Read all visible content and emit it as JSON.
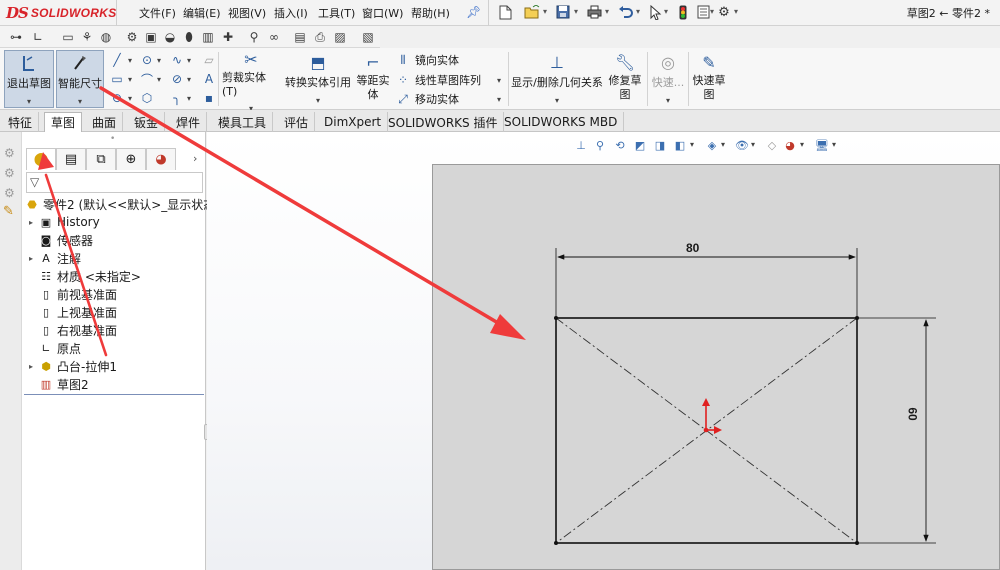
{
  "app": {
    "logo_ds": "DS",
    "logo_name": "SOLIDWORKS",
    "title": "草图2 ← 零件2 *",
    "colors": {
      "brand_red": "#d8232a",
      "sketch_line": "#111111",
      "origin_red": "#e02020",
      "arrow_red": "#ef3b3b"
    }
  },
  "menu": {
    "items": [
      "文件(F)",
      "编辑(E)",
      "视图(V)",
      "插入(I)",
      "工具(T)",
      "窗口(W)",
      "帮助(H)"
    ],
    "pin_icon": "pin-icon"
  },
  "quick_access": {
    "icons": [
      "new-document-icon",
      "open-icon",
      "save-icon",
      "print-icon",
      "undo-icon",
      "select-icon",
      "rebuild-icon",
      "file-properties-icon",
      "options-icon"
    ]
  },
  "command_manager": {
    "exit_sketch": "退出草图",
    "smart_dimension": "智能尺寸",
    "trim_entities": "剪裁实体(T)",
    "convert_entities": "转换实体引用",
    "offset_entities": "等距实体",
    "mirror_entities": "镜向实体",
    "linear_pattern": "线性草图阵列",
    "move_entities": "移动实体",
    "display_delete_relations": "显示/删除几何关系",
    "repair_sketch": "修复草图",
    "quick_snaps": "快速...",
    "rapid_sketch": "快速草图"
  },
  "tabs": [
    {
      "label": "特征",
      "active": false
    },
    {
      "label": "草图",
      "active": true
    },
    {
      "label": "曲面",
      "active": false
    },
    {
      "label": "钣金",
      "active": false
    },
    {
      "label": "焊件",
      "active": false
    },
    {
      "label": "模具工具",
      "active": false
    },
    {
      "label": "评估",
      "active": false
    },
    {
      "label": "DimXpert",
      "active": false
    },
    {
      "label": "SOLIDWORKS 插件",
      "active": false
    },
    {
      "label": "SOLIDWORKS MBD",
      "active": false
    }
  ],
  "feature_tree": {
    "root": "零件2  (默认<<默认>_显示状态",
    "items": [
      {
        "label": "History",
        "icon": "history-folder-icon",
        "expandable": true
      },
      {
        "label": "传感器",
        "icon": "sensor-icon",
        "expandable": false
      },
      {
        "label": "注解",
        "icon": "annotations-icon",
        "expandable": true
      },
      {
        "label": "材质 <未指定>",
        "icon": "material-icon",
        "expandable": false
      },
      {
        "label": "前视基准面",
        "icon": "plane-icon",
        "expandable": false
      },
      {
        "label": "上视基准面",
        "icon": "plane-icon",
        "expandable": false
      },
      {
        "label": "右视基准面",
        "icon": "plane-icon",
        "expandable": false
      },
      {
        "label": "原点",
        "icon": "origin-icon",
        "expandable": false
      },
      {
        "label": "凸台-拉伸1",
        "icon": "extrude-icon",
        "expandable": true
      },
      {
        "label": "草图2",
        "icon": "sketch-icon",
        "expandable": false
      }
    ]
  },
  "sketch": {
    "dimension_width": "80",
    "dimension_height": "60"
  }
}
